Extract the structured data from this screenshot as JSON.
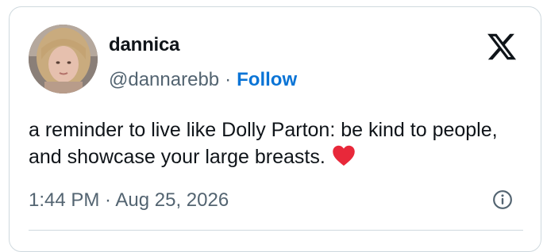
{
  "tweet": {
    "author": {
      "display_name": "dannica",
      "handle": "@dannarebb",
      "avatar_icon": "profile-photo"
    },
    "separator": "·",
    "follow_label": "Follow",
    "text": "a reminder to live like Dolly Parton: be kind to people, and showcase your large breasts.",
    "emoji": "heart",
    "timestamp": "1:44 PM · Aug 25, 2026",
    "brand_icon": "x-logo-icon",
    "info_icon": "info-icon"
  },
  "colors": {
    "text_primary": "#0f1419",
    "text_secondary": "#536471",
    "follow_link": "#0a74d6",
    "border": "#cfd9de",
    "heart": "#e8283a"
  }
}
